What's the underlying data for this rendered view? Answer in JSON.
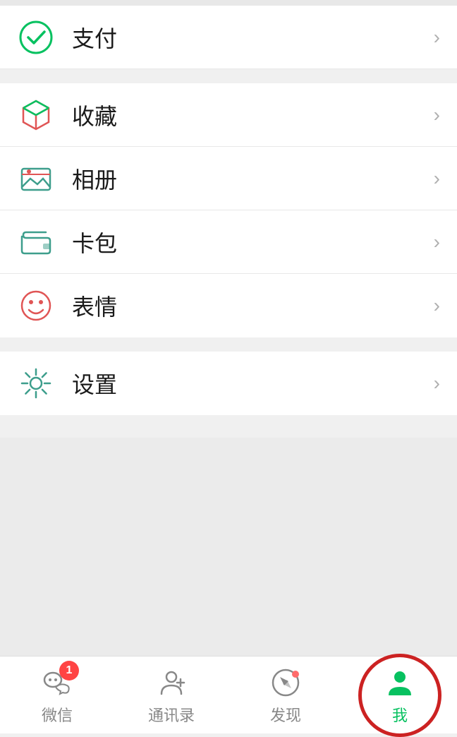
{
  "menu": {
    "items": [
      {
        "id": "payment",
        "label": "支付",
        "icon": "payment-icon"
      },
      {
        "id": "favorites",
        "label": "收藏",
        "icon": "favorites-icon"
      },
      {
        "id": "album",
        "label": "相册",
        "icon": "album-icon"
      },
      {
        "id": "wallet",
        "label": "卡包",
        "icon": "wallet-icon"
      },
      {
        "id": "stickers",
        "label": "表情",
        "icon": "stickers-icon"
      }
    ],
    "settings_item": {
      "label": "设置",
      "icon": "settings-icon"
    }
  },
  "bottom_nav": {
    "items": [
      {
        "id": "wechat",
        "label": "微信",
        "badge": "1",
        "active": false
      },
      {
        "id": "contacts",
        "label": "通讯录",
        "badge": "",
        "active": false
      },
      {
        "id": "discover",
        "label": "发现",
        "badge": "",
        "active": false
      },
      {
        "id": "me",
        "label": "我",
        "badge": "",
        "active": true
      }
    ]
  },
  "colors": {
    "green": "#07c160",
    "teal": "#3d9e8c",
    "red": "#e05555",
    "pink": "#e57373",
    "gray": "#888888",
    "active_red_ring": "#cc2222"
  }
}
